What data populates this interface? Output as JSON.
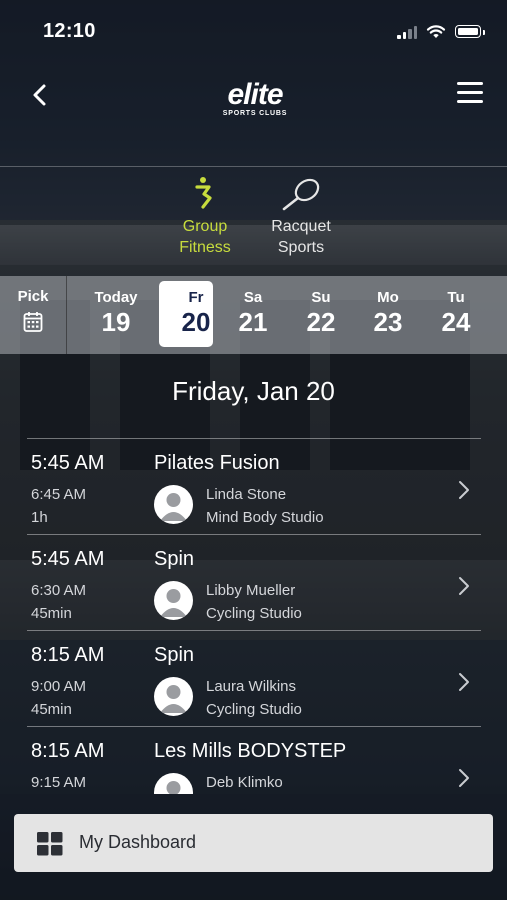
{
  "status_bar": {
    "time": "12:10"
  },
  "header": {
    "logo_word": "elite",
    "logo_sub": "SPORTS CLUBS"
  },
  "categories": [
    {
      "line1": "Group",
      "line2": "Fitness",
      "icon": "group-fitness-icon",
      "active": true
    },
    {
      "line1": "Racquet",
      "line2": "Sports",
      "icon": "racquet-icon",
      "active": false
    }
  ],
  "date_strip": {
    "pick_label": "Pick",
    "days": [
      {
        "name": "Today",
        "date": "19"
      },
      {
        "name": "Fr",
        "date": "20",
        "selected": true
      },
      {
        "name": "Sa",
        "date": "21"
      },
      {
        "name": "Su",
        "date": "22"
      },
      {
        "name": "Mo",
        "date": "23"
      },
      {
        "name": "Tu",
        "date": "24"
      }
    ]
  },
  "day_heading": "Friday, Jan 20",
  "classes": [
    {
      "start": "5:45 AM",
      "end": "6:45 AM",
      "duration": "1h",
      "title": "Pilates Fusion",
      "instructor": "Linda Stone",
      "location": "Mind Body Studio"
    },
    {
      "start": "5:45 AM",
      "end": "6:30 AM",
      "duration": "45min",
      "title": "Spin",
      "instructor": "Libby Mueller",
      "location": "Cycling Studio"
    },
    {
      "start": "8:15 AM",
      "end": "9:00 AM",
      "duration": "45min",
      "title": "Spin",
      "instructor": "Laura Wilkins",
      "location": "Cycling Studio"
    },
    {
      "start": "8:15 AM",
      "end": "9:15 AM",
      "duration": "",
      "title": "Les Mills BODYSTEP",
      "instructor": "Deb Klimko",
      "location": ""
    }
  ],
  "dashboard_button": {
    "label": "My Dashboard"
  },
  "colors": {
    "accent": "#c7dc3d",
    "selected_date_text": "#18244a"
  }
}
